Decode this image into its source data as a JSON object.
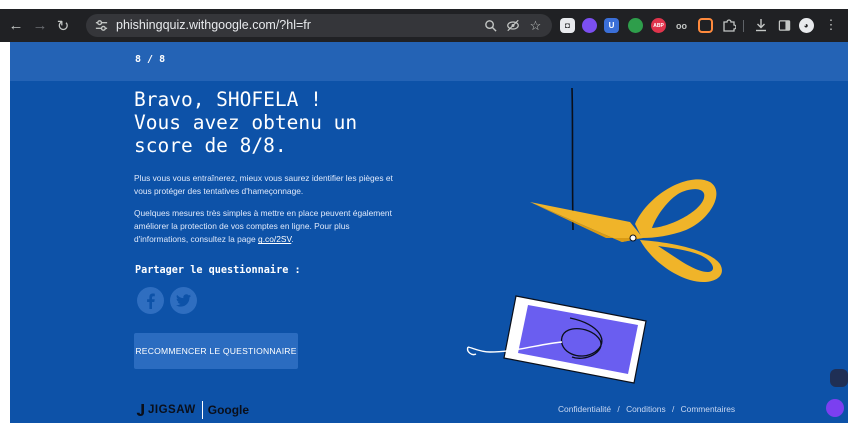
{
  "browser": {
    "url": "phishingquiz.withgoogle.com/?hl=fr",
    "extensions": [
      {
        "name": "1password-icon",
        "color": "#1a73e8",
        "glyph": "◘"
      },
      {
        "name": "colorful-orb-icon",
        "color": "#7b4ff0",
        "glyph": "●"
      },
      {
        "name": "bitwarden-icon",
        "color": "#3b6fd8",
        "glyph": "U"
      },
      {
        "name": "green-extension-icon",
        "color": "#2e9e4b",
        "glyph": "●"
      },
      {
        "name": "adblock-plus-icon",
        "color": "#e0344c",
        "glyph": "ABP"
      },
      {
        "name": "glasses-icon",
        "color": "#202124",
        "glyph": "oo"
      },
      {
        "name": "rainbow-ring-icon",
        "color": "#ff5a5a",
        "glyph": "○"
      }
    ]
  },
  "progress": {
    "label": "8 / 8"
  },
  "result": {
    "line1": "Bravo, SHOFELA !",
    "line2": "Vous avez obtenu un",
    "line3": "score de 8/8."
  },
  "paragraphs": {
    "p1": "Plus vous vous entraînerez, mieux vous saurez identifier les pièges et vous protéger des tentatives d'hameçonnage.",
    "p2_text": "Quelques mesures très simples à mettre en place peuvent également améliorer la protection de vos comptes en ligne. Pour plus d'informations, consultez la page ",
    "p2_link": "g.co/2SV",
    "p2_end": "."
  },
  "share": {
    "label": "Partager le questionnaire :",
    "networks": [
      "facebook",
      "twitter"
    ]
  },
  "restart_button": "RECOMMENCER LE QUESTIONNAIRE",
  "footer": {
    "brand_left": "JIGSAW",
    "brand_right": "Google",
    "links": [
      "Confidentialité",
      "Conditions",
      "Commentaires"
    ],
    "separator": "/"
  },
  "colors": {
    "page_background": "#0d52a8",
    "top_band": "#2463b5",
    "scissors": "#f0b429",
    "phone_screen": "#6a5ef0"
  }
}
